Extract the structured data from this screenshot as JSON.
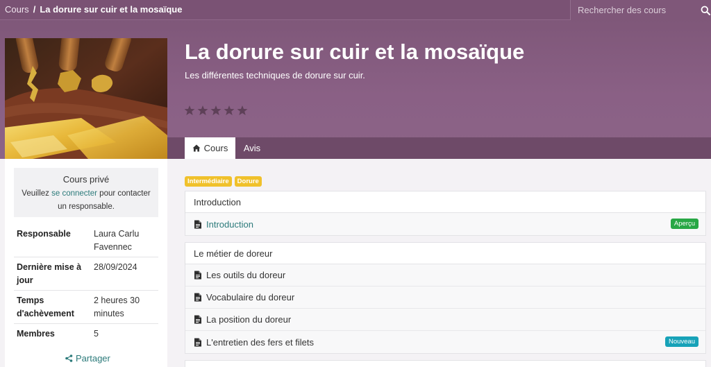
{
  "breadcrumb": {
    "root": "Cours",
    "separator": "/",
    "current": "La dorure sur cuir et la mosaïque"
  },
  "search": {
    "placeholder": "Rechercher des cours",
    "value": ""
  },
  "course": {
    "title": "La dorure sur cuir et la mosaïque",
    "subtitle": "Les différentes techniques de dorure sur cuir.",
    "rating": 0,
    "stars_total": 5
  },
  "tabs": [
    {
      "label": "Cours",
      "active": true,
      "icon": "home-icon"
    },
    {
      "label": "Avis",
      "active": false
    }
  ],
  "sidebar": {
    "private": {
      "title": "Cours privé",
      "text_before": "Veuillez ",
      "link": "se connecter",
      "text_after": " pour contacter un responsable."
    },
    "info": [
      {
        "key": "Responsable",
        "value": "Laura Carlu Favennec"
      },
      {
        "key": "Dernière mise à jour",
        "value": "28/09/2024"
      },
      {
        "key": "Temps d'achèvement",
        "value": "2 heures 30 minutes"
      },
      {
        "key": "Membres",
        "value": "5"
      }
    ],
    "share_label": "Partager"
  },
  "tags": [
    "Intermédiaire",
    "Dorure"
  ],
  "sections": [
    {
      "title": "Introduction",
      "lessons": [
        {
          "label": "Introduction",
          "link": true,
          "badge": "Aperçu",
          "badge_color": "#28a745"
        }
      ]
    },
    {
      "title": "Le métier de doreur",
      "lessons": [
        {
          "label": "Les outils du doreur"
        },
        {
          "label": "Vocabulaire du doreur"
        },
        {
          "label": "La position du doreur"
        },
        {
          "label": "L'entretien des fers et filets",
          "badge": "Nouveau",
          "badge_color": "#17a2b8"
        }
      ]
    }
  ],
  "colors": {
    "header": "#7c5576",
    "accent_link": "#2b7a7a",
    "tag": "#f0c12b"
  }
}
